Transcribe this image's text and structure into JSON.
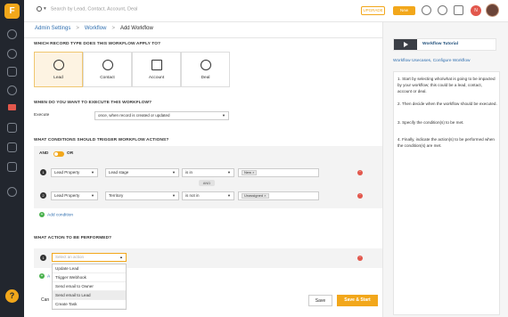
{
  "sidebar": {
    "logo": "F",
    "help": "?"
  },
  "topbar": {
    "search_placeholder": "Search by Lead, Contact, Account, Deal",
    "upgrade_label": "UPGRADE",
    "new_label": "New",
    "notification_initial": "N"
  },
  "breadcrumb": {
    "items": [
      "Admin Settings",
      ">",
      "Workflow",
      ">",
      "Add Workflow"
    ]
  },
  "record_section": {
    "heading": "WHICH RECORD TYPE DOES THIS WORKFLOW APPLY TO?",
    "cards": [
      {
        "label": "Lead",
        "selected": true
      },
      {
        "label": "Contact"
      },
      {
        "label": "Account"
      },
      {
        "label": "Deal"
      }
    ]
  },
  "execute_section": {
    "heading": "WHEN DO YOU WANT TO EXECUTE THIS WORKFLOW?",
    "label": "Execute",
    "value": "once, when record is created or updated"
  },
  "conditions_section": {
    "heading": "WHAT CONDITIONS SHOULD TRIGGER WORKFLOW ACTIONS?",
    "and_label": "AND",
    "or_label": "OR",
    "and_separator": "AND",
    "rows": [
      {
        "num": "1",
        "property": "Lead Property",
        "field": "Lead stage",
        "operator": "is in",
        "tag": "New"
      },
      {
        "num": "2",
        "property": "Lead Property",
        "field": "Territory",
        "operator": "is not in",
        "tag": "Unassigned"
      }
    ],
    "add_label": "Add condition"
  },
  "action_section": {
    "heading": "WHAT ACTION TO BE PERFORMED?",
    "num": "1",
    "placeholder": "Select an action",
    "options": [
      "Update Lead",
      "Trigger Webhook",
      "Send email to Owner",
      "Send email to Lead",
      "Create Task"
    ],
    "highlighted": "Send email to Lead",
    "add_prefix": "A"
  },
  "footer": {
    "cancel_label": "Can",
    "save_label": "Save",
    "save_start_label": "Save & Start"
  },
  "help_panel": {
    "video_title": "Workflow Tutorial",
    "link": "Workflow Usecases, Configure Workflow",
    "steps": [
      "1. Start by selecting who/what is going to be impacted by your workflow; this could be a lead, contact, account or deal.",
      "2. Then decide when the workflow should be executed.",
      "3. Specify the condition(s) to be met.",
      "4. Finally, indicate the action(s) to be performed when the condition(s) are met."
    ]
  },
  "colors": {
    "accent": "#f2a71b",
    "link": "#2f6fb0",
    "sidebar": "#22262e",
    "danger": "#e2574c",
    "success": "#47b04b"
  }
}
